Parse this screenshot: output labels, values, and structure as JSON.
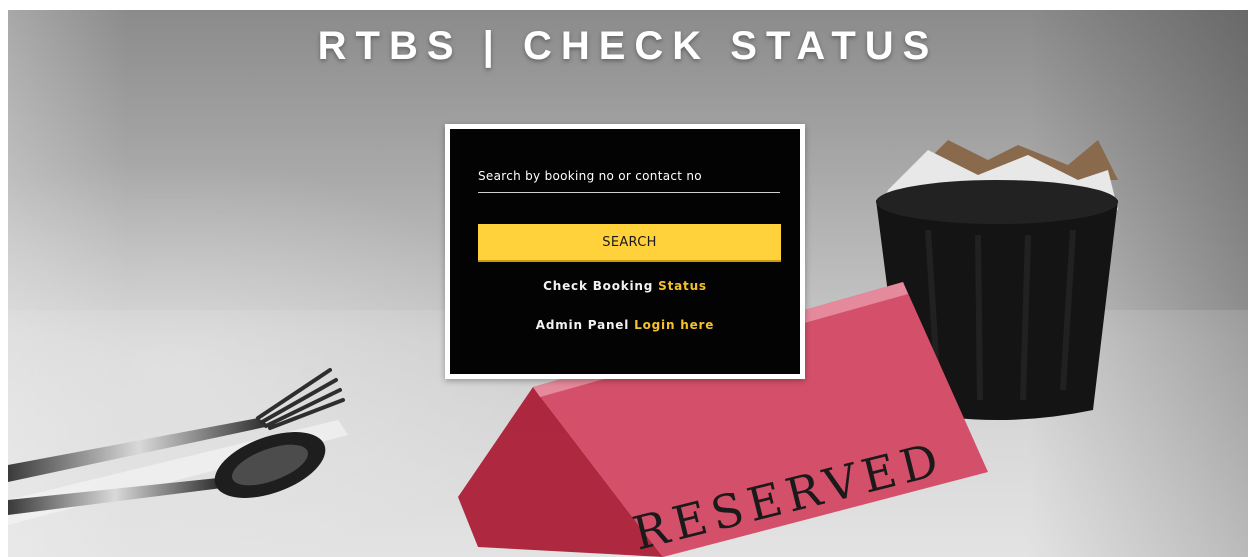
{
  "header": {
    "title": "RTBS | CHECK STATUS"
  },
  "search": {
    "placeholder": "Search by booking no or contact no",
    "value": "",
    "button_label": "SEARCH"
  },
  "links": {
    "check_prefix": "Check Booking",
    "check_link": "Status",
    "admin_prefix": "Admin Panel",
    "admin_link": "Login here"
  },
  "background": {
    "sign_text": "RESERVED"
  },
  "colors": {
    "accent": "#ffd13a",
    "link_accent": "#f6c12c",
    "card_bg": "#030303",
    "card_border": "#ffffff",
    "sign": "#d4506a"
  }
}
